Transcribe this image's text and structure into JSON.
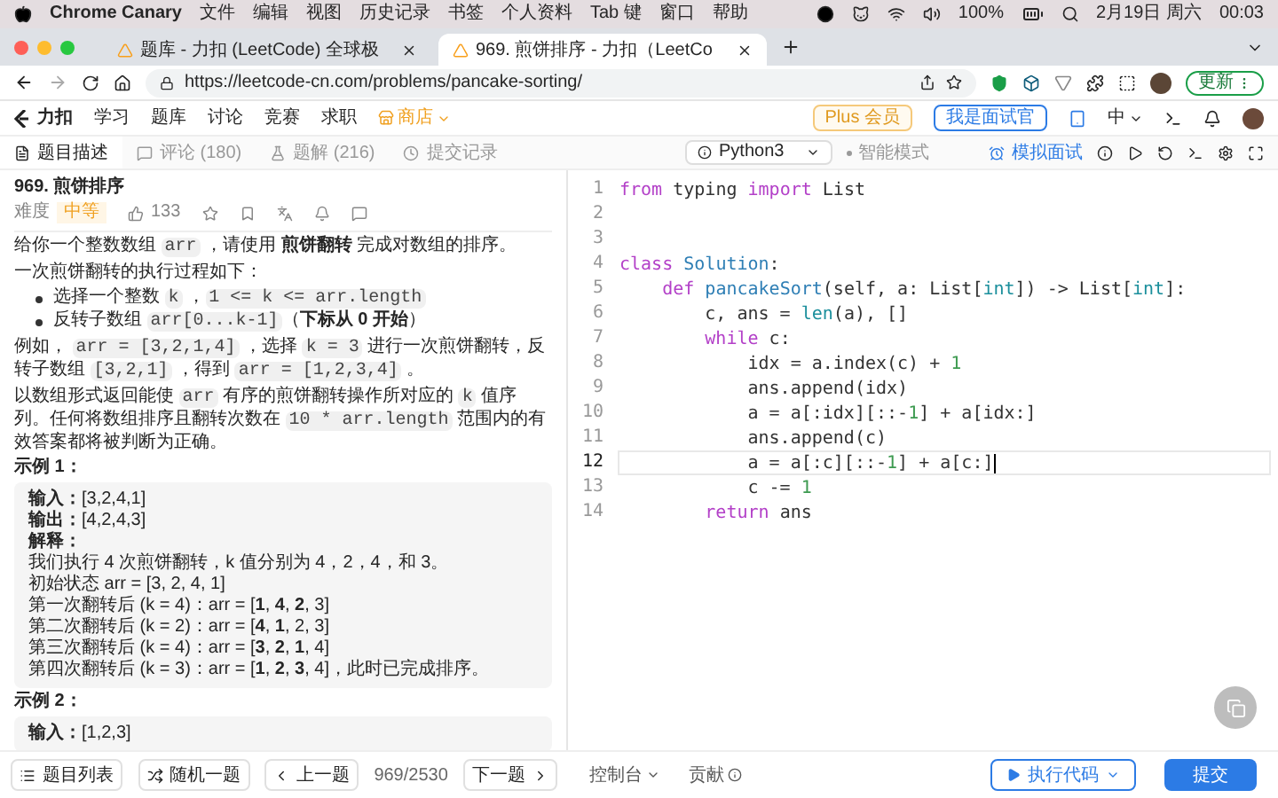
{
  "menubar": {
    "app": "Chrome Canary",
    "items": [
      "文件",
      "编辑",
      "视图",
      "历史记录",
      "书签",
      "个人资料",
      "Tab 键",
      "窗口",
      "帮助"
    ],
    "battery": "100%",
    "date": "2月19日 周六",
    "time": "00:03"
  },
  "browser": {
    "tabs": [
      {
        "title": "题库 - 力扣 (LeetCode) 全球极",
        "selected": false
      },
      {
        "title": "969. 煎饼排序 - 力扣（LeetCo",
        "selected": true
      }
    ],
    "url": "https://leetcode-cn.com/problems/pancake-sorting/",
    "update_button": "更新"
  },
  "site_nav": {
    "logo": "力扣",
    "items": [
      {
        "label": "学习",
        "kind": "link"
      },
      {
        "label": "题库",
        "kind": "link"
      },
      {
        "label": "讨论",
        "kind": "link"
      },
      {
        "label": "竞赛",
        "kind": "link"
      },
      {
        "label": "求职",
        "kind": "link"
      },
      {
        "label": "商店",
        "kind": "store"
      }
    ],
    "plus_button": "Plus 会员",
    "interviewer_button": "我是面试官",
    "language": "中"
  },
  "panel_tabs": [
    {
      "label": "题目描述",
      "selected": true
    },
    {
      "label": "评论 (180)",
      "selected": false
    },
    {
      "label": "题解 (216)",
      "selected": false
    },
    {
      "label": "提交记录",
      "selected": false
    }
  ],
  "editor_toolbar": {
    "language": "Python3",
    "mode": "智能模式",
    "mock_interview": "模拟面试"
  },
  "problem": {
    "title": "969. 煎饼排序",
    "difficulty_label": "难度",
    "difficulty": "中等",
    "likes": "133",
    "blocks": [
      {
        "kind": "paragraph",
        "segments": [
          {
            "kind": "text",
            "text": "给你一个整数数组 "
          },
          {
            "kind": "code",
            "text": "arr"
          },
          {
            "kind": "text",
            "text": " ，请使用 "
          },
          {
            "kind": "bold",
            "text": "煎饼翻转"
          },
          {
            "kind": "text",
            "text": " 完成对数组的排序。"
          }
        ]
      },
      {
        "kind": "paragraph",
        "segments": [
          {
            "kind": "text",
            "text": "一次煎饼翻转的执行过程如下："
          }
        ]
      },
      {
        "kind": "bullets",
        "items": [
          [
            {
              "kind": "text",
              "text": "选择一个整数 "
            },
            {
              "kind": "code",
              "text": "k"
            },
            {
              "kind": "text",
              "text": " ，"
            },
            {
              "kind": "code",
              "text": "1 <= k <= arr.length"
            }
          ],
          [
            {
              "kind": "text",
              "text": "反转子数组 "
            },
            {
              "kind": "code",
              "text": "arr[0...k-1]"
            },
            {
              "kind": "text",
              "text": "（"
            },
            {
              "kind": "bold",
              "text": "下标从 0 开始"
            },
            {
              "kind": "text",
              "text": "）"
            }
          ]
        ]
      },
      {
        "kind": "paragraph",
        "segments": [
          {
            "kind": "text",
            "text": "例如， "
          },
          {
            "kind": "code",
            "text": "arr = [3,2,1,4]"
          },
          {
            "kind": "text",
            "text": " ，选择 "
          },
          {
            "kind": "code",
            "text": "k = 3"
          },
          {
            "kind": "text",
            "text": " 进行一次煎饼翻转，反转子数组 "
          },
          {
            "kind": "code",
            "text": "[3,2,1]"
          },
          {
            "kind": "text",
            "text": " ，得到 "
          },
          {
            "kind": "code",
            "text": "arr = [1,2,3,4]"
          },
          {
            "kind": "text",
            "text": " 。"
          }
        ]
      },
      {
        "kind": "paragraph",
        "segments": [
          {
            "kind": "text",
            "text": "以数组形式返回能使 "
          },
          {
            "kind": "code",
            "text": "arr"
          },
          {
            "kind": "text",
            "text": " 有序的煎饼翻转操作所对应的 "
          },
          {
            "kind": "code",
            "text": "k"
          },
          {
            "kind": "text",
            "text": " 值序列。任何将数组排序且翻转次数在 "
          },
          {
            "kind": "code",
            "text": "10 * arr.length"
          },
          {
            "kind": "text",
            "text": " 范围内的有效答案都将被判断为正确。"
          }
        ]
      },
      {
        "kind": "heading",
        "text": "示例 1："
      },
      {
        "kind": "example",
        "lines": [
          "**输入：**[3,2,4,1]",
          "**输出：**[4,2,4,3]",
          "**解释：**",
          "我们执行 4 次煎饼翻转，k 值分别为 4，2，4，和 3。",
          "初始状态 arr = [3, 2, 4, 1]",
          "第一次翻转后 (k = 4)：arr = [**1**, **4**, **2**, 3]",
          "第二次翻转后 (k = 2)：arr = [**4**, **1**, 2, 3]",
          "第三次翻转后 (k = 4)：arr = [**3**, **2**, **1**, 4]",
          "第四次翻转后 (k = 3)：arr = [**1**, **2**, **3**, 4]，此时已完成排序。"
        ]
      },
      {
        "kind": "heading",
        "text": "示例 2："
      },
      {
        "kind": "example",
        "lines": [
          "**输入：**[1,2,3]"
        ]
      }
    ]
  },
  "code": {
    "lines": [
      {
        "number": "1",
        "active": false,
        "tokens": [
          {
            "kind": "keyword",
            "text": "from"
          },
          {
            "kind": "plain",
            "text": " typing "
          },
          {
            "kind": "keyword",
            "text": "import"
          },
          {
            "kind": "plain",
            "text": " List"
          }
        ]
      },
      {
        "number": "2",
        "active": false
      },
      {
        "number": "3",
        "active": false
      },
      {
        "number": "4",
        "active": false,
        "tokens": [
          {
            "kind": "keyword",
            "text": "class"
          },
          {
            "kind": "name",
            "text": " Solution"
          },
          {
            "kind": "plain",
            "text": ":"
          }
        ]
      },
      {
        "number": "5",
        "active": false,
        "tokens": [
          {
            "kind": "keyword",
            "text": "    def"
          },
          {
            "kind": "name",
            "text": " pancakeSort"
          },
          {
            "kind": "plain",
            "text": "(self, a: List["
          },
          {
            "kind": "builtin",
            "text": "int"
          },
          {
            "kind": "plain",
            "text": "]) -> List["
          },
          {
            "kind": "builtin",
            "text": "int"
          },
          {
            "kind": "plain",
            "text": "]:"
          }
        ]
      },
      {
        "number": "6",
        "active": false,
        "tokens": [
          {
            "kind": "plain",
            "text": "        c, ans = "
          },
          {
            "kind": "builtin",
            "text": "len"
          },
          {
            "kind": "plain",
            "text": "(a), []"
          }
        ]
      },
      {
        "number": "7",
        "active": false,
        "tokens": [
          {
            "kind": "keyword",
            "text": "        while"
          },
          {
            "kind": "plain",
            "text": " c:"
          }
        ]
      },
      {
        "number": "8",
        "active": false,
        "tokens": [
          {
            "kind": "plain",
            "text": "            idx = a.index(c) + "
          },
          {
            "kind": "number",
            "text": "1"
          }
        ]
      },
      {
        "number": "9",
        "active": false,
        "tokens": [
          {
            "kind": "plain",
            "text": "            ans.append(idx)"
          }
        ]
      },
      {
        "number": "10",
        "active": false,
        "tokens": [
          {
            "kind": "plain",
            "text": "            a = a[:idx][::-"
          },
          {
            "kind": "number",
            "text": "1"
          },
          {
            "kind": "plain",
            "text": "] + a[idx:]"
          }
        ]
      },
      {
        "number": "11",
        "active": false,
        "tokens": [
          {
            "kind": "plain",
            "text": "            ans.append(c)"
          }
        ]
      },
      {
        "number": "12",
        "active": true,
        "tokens": [
          {
            "kind": "plain",
            "text": "            a = a[:c][::-"
          },
          {
            "kind": "number",
            "text": "1"
          },
          {
            "kind": "plain",
            "text": "] + a[c:]"
          }
        ]
      },
      {
        "number": "13",
        "active": false,
        "tokens": [
          {
            "kind": "plain",
            "text": "            c -= "
          },
          {
            "kind": "number",
            "text": "1"
          }
        ]
      },
      {
        "number": "14",
        "active": false,
        "tokens": [
          {
            "kind": "keyword",
            "text": "        return"
          },
          {
            "kind": "plain",
            "text": " ans"
          }
        ]
      }
    ]
  },
  "bottom_bar": {
    "problem_list": "题目列表",
    "random": "随机一题",
    "prev": "上一题",
    "position": "969/2530",
    "next": "下一题",
    "console": "控制台",
    "contribute": "贡献",
    "run": "执行代码",
    "submit": "提交"
  }
}
